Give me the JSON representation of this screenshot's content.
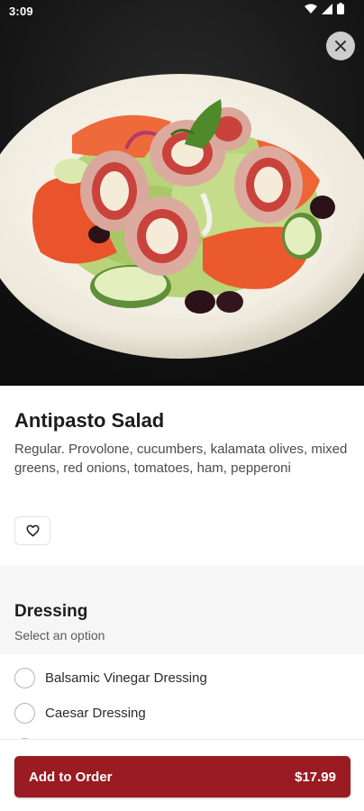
{
  "status_bar": {
    "time": "3:09"
  },
  "item": {
    "name": "Antipasto Salad",
    "description": "Regular. Provolone, cucumbers, kalamata olives, mixed greens, red onions, tomatoes, ham, pepperoni",
    "favorite_icon": "heart-outline-icon",
    "close_icon": "close-icon"
  },
  "option_group": {
    "title": "Dressing",
    "subtitle": "Select an option",
    "options": [
      {
        "label": "Balsamic Vinegar Dressing",
        "selected": false
      },
      {
        "label": "Caesar Dressing",
        "selected": false
      },
      {
        "label": "",
        "selected": false
      }
    ]
  },
  "footer": {
    "add_label": "Add to Order",
    "price": "$17.99"
  },
  "colors": {
    "accent": "#9a1b22",
    "hero_background": "#131313",
    "section_background": "#f6f6f6"
  }
}
